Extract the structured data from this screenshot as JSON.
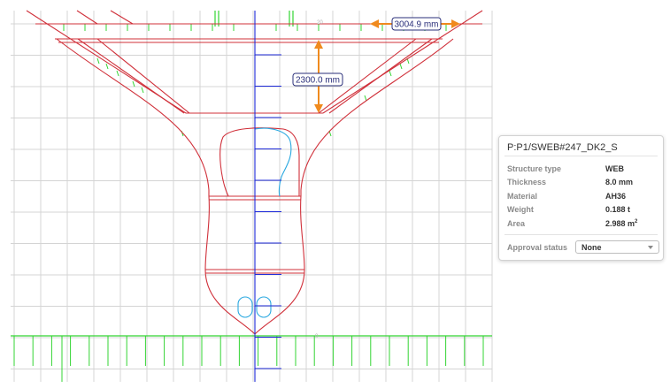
{
  "viewport": {
    "dimensions": [
      {
        "name": "top-width-dimension",
        "label": "3004.9 mm"
      },
      {
        "name": "height-dimension",
        "label": "2300.0 mm"
      }
    ],
    "grid_labels": {
      "top": "20",
      "bottom": "0"
    },
    "colors": {
      "grid": "#d4d4d4",
      "structure": "#d0303a",
      "centerline": "#1e2ad8",
      "stiffener": "#33d433",
      "highlight": "#29a8e0",
      "dimension": "#f08a1e"
    }
  },
  "panel": {
    "title": "P:P1/SWEB#247_DK2_S",
    "properties": [
      {
        "label": "Structure type",
        "value": "WEB"
      },
      {
        "label": "Thickness",
        "value": "8.0 mm"
      },
      {
        "label": "Material",
        "value": "AH36"
      },
      {
        "label": "Weight",
        "value": "0.188 t"
      },
      {
        "label": "Area",
        "value": "2.988 m",
        "sup": "2"
      }
    ],
    "approval": {
      "label": "Approval status",
      "value": "None",
      "icon": "chevron-down-icon"
    }
  }
}
